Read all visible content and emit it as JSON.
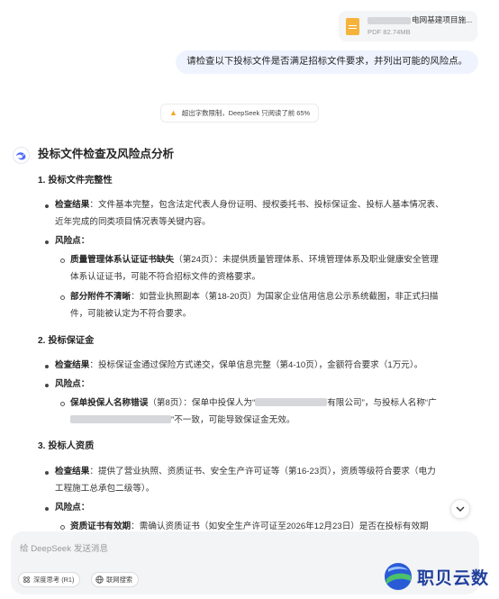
{
  "attachment": {
    "name_suffix": "电网基建项目施...",
    "size": "PDF 82.74MB"
  },
  "user_message": "请检查以下投标文件是否满足招标文件要求，并列出可能的风险点。",
  "notice": "超出字数限制，DeepSeek 只阅读了前 65%",
  "answer": {
    "title": "投标文件检查及风险点分析",
    "s1": {
      "heading": "1. 投标文件完整性",
      "check_label": "检查结果",
      "check_l1": "：文件基本完整，包含法定代表人身份证明、授权委托书、投标保证金、投标人基本情况表、",
      "check_l2": "近年完成的同类项目情况表等关键内容。",
      "risk_label": "风险点：",
      "r1_label": "质量管理体系认证证书缺失",
      "r1_l1": "（第24页）：未提供质量管理体系、环境管理体系及职业健康安全管理",
      "r1_l2": "体系认证证书，可能不符合招标文件的资格要求。",
      "r2_label": "部分附件不清晰",
      "r2_l1": "：如营业执照副本（第18-20页）为国家企业信用信息公示系统截图，非正式扫描",
      "r2_l2": "件，可能被认定为不符合要求。"
    },
    "s2": {
      "heading": "2. 投标保证金",
      "check_label": "检查结果",
      "check_l1": "：投标保证金通过保险方式递交，保单信息完整（第4-10页），金额符合要求（1万元）。",
      "risk_label": "风险点：",
      "r1_label": "保单投保人名称错误",
      "r1_l1a": "（第8页）：保单中投保人为“",
      "r1_l1b": "有限公司”，与投标人名称“广",
      "r1_l2": "”不一致，可能导致保证金无效。"
    },
    "s3": {
      "heading": "3. 投标人资质",
      "check_label": "检查结果",
      "check_l1": "：提供了营业执照、资质证书、安全生产许可证等（第16-23页），资质等级符合要求（电力",
      "check_l2": "工程施工总承包二级等）。",
      "risk_label": "风险点：",
      "r1_label": "资质证书有效期",
      "r1_l1": "：需确认资质证书（如安全生产许可证至2026年12月23日）是否在投标有效期"
    }
  },
  "input": {
    "placeholder": "给 DeepSeek 发送消息",
    "deep_think": "深度思考 (R1)",
    "web_search": "联网搜索"
  },
  "watermark": "职贝云数",
  "colors": {
    "accent": "#4d6bfe",
    "warning": "#f5a623",
    "watermark": "#1f3f9c"
  },
  "icons": [
    "file-pdf-icon",
    "warning-icon",
    "deepseek-whale-icon",
    "chevron-down-icon",
    "deep-think-icon",
    "globe-icon"
  ]
}
